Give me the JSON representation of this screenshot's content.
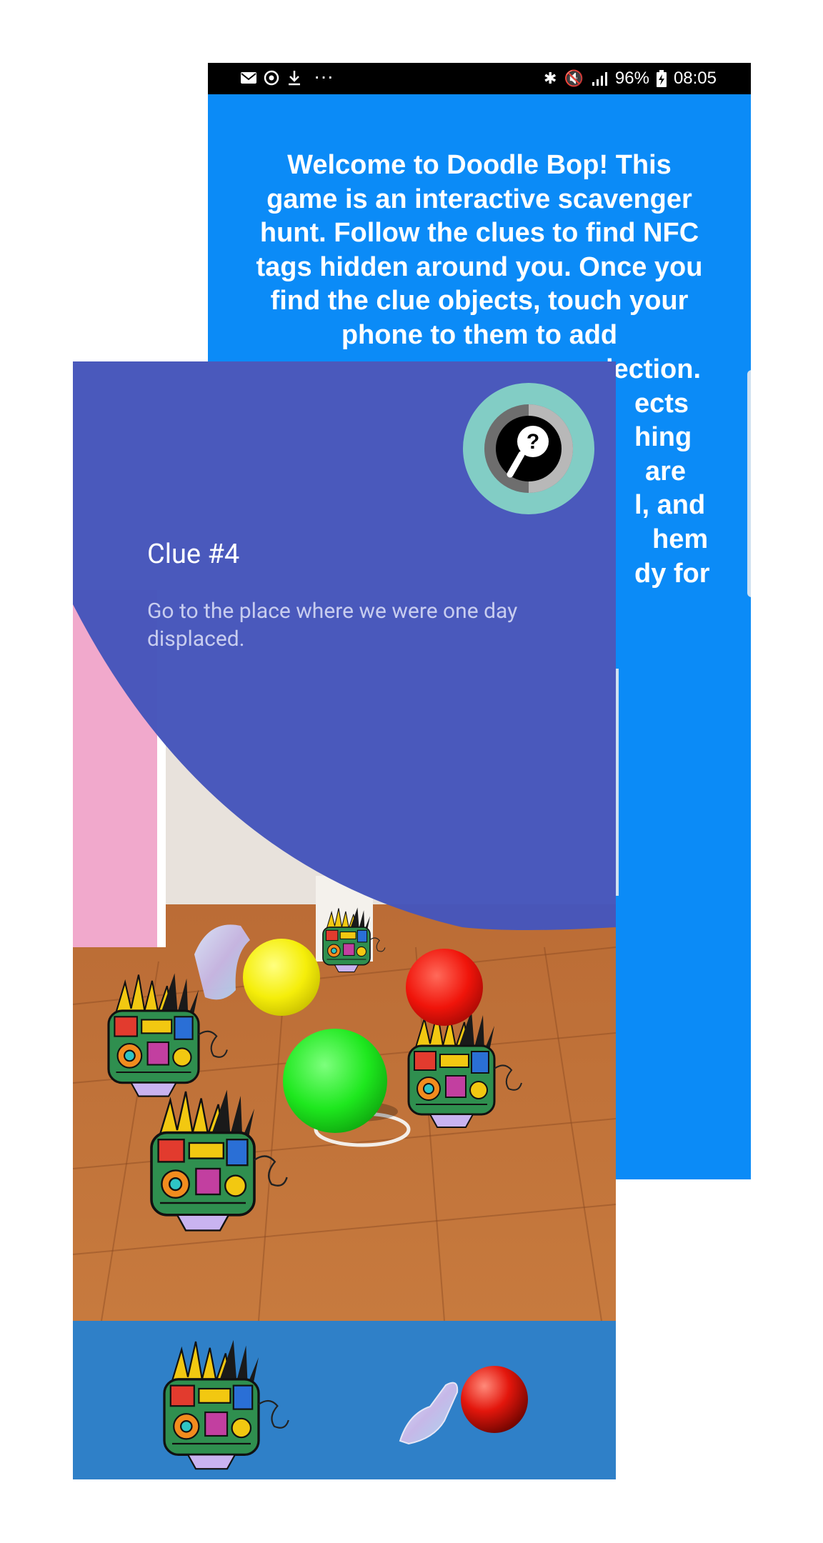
{
  "status_bar": {
    "battery_percent": "96%",
    "time": "08:05",
    "more_indicator": "···"
  },
  "welcome": {
    "text": "Welcome to Doodle Bop! This game is an interactive scavenger hunt. Follow the clues to find NFC tags hidden around you. Once you find the clue objects, touch your phone to them to add",
    "hidden_fragments": [
      "lection.",
      "ects",
      "hing",
      "are",
      "l, and",
      "hem",
      "dy for"
    ]
  },
  "clue": {
    "title": "Clue #4",
    "text": "Go to the place where we were one day displaced."
  },
  "help_button": {
    "icon": "magnifier-question-icon"
  },
  "colors": {
    "welcome_background": "#0b8bf7",
    "clue_panel": "#4656bb",
    "help_ring": "#82cdc5",
    "collection_bar": "#2f80c8",
    "ball_yellow": "#f5ee0a",
    "ball_green": "#1ee81e",
    "ball_red": "#f0140a"
  }
}
